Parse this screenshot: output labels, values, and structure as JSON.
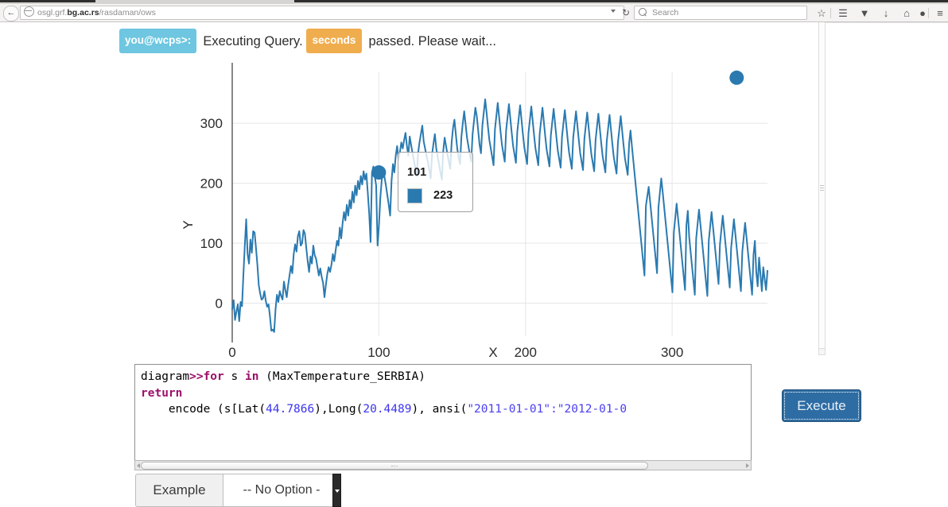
{
  "browser": {
    "back_icon": "back-arrow-icon",
    "url_prefix": "osgl.grf.",
    "url_domain": "bg.ac.rs",
    "url_suffix": "/rasdaman/ows",
    "reload_glyph": "↻",
    "search_placeholder": "Search",
    "icons": {
      "star": "☆",
      "reader": "☰",
      "pocket": "▼",
      "download": "↓",
      "home": "⌂",
      "sync": "●",
      "menu": "≡"
    }
  },
  "status": {
    "prompt": "you@wcps>:",
    "text_before": "Executing Query.",
    "seconds_badge": "seconds",
    "text_after": "passed. Please wait..."
  },
  "chart_data": {
    "type": "line",
    "title": "",
    "xlabel": "X",
    "ylabel": "Y",
    "xlim": [
      0,
      365
    ],
    "ylim": [
      -55,
      385
    ],
    "xticks": [
      0,
      100,
      200,
      300
    ],
    "yticks": [
      0,
      100,
      200,
      300
    ],
    "grid": true,
    "legend": "none",
    "line_color": "#2a7ab0",
    "marker_color": "#2a7ab0",
    "markers": [
      {
        "x": 100,
        "y": 218
      },
      {
        "x": 344,
        "y": 376
      }
    ],
    "series": [
      {
        "name": "MaxTemperature_SERBIA",
        "values": [
          -10,
          5,
          -28,
          -14,
          -2,
          -30,
          2,
          -5,
          48,
          96,
          140,
          82,
          66,
          106,
          84,
          120,
          118,
          92,
          64,
          30,
          16,
          6,
          8,
          20,
          4,
          -6,
          -2,
          -22,
          -46,
          -44,
          -48,
          -10,
          14,
          2,
          20,
          12,
          6,
          36,
          22,
          10,
          30,
          46,
          62,
          50,
          82,
          98,
          86,
          112,
          120,
          96,
          100,
          122,
          116,
          92,
          70,
          52,
          78,
          66,
          96,
          80,
          74,
          60,
          46,
          58,
          44,
          34,
          10,
          30,
          48,
          60,
          52,
          64,
          82,
          70,
          88,
          104,
          96,
          126,
          108,
          134,
          152,
          138,
          164,
          146,
          172,
          158,
          186,
          168,
          196,
          180,
          204,
          190,
          212,
          198,
          220,
          206,
          216,
          184,
          150,
          102,
          218,
          228,
          212,
          196,
          96,
          130,
          176,
          206,
          224,
          210,
          196,
          180,
          164,
          146,
          204,
          232,
          218,
          246,
          262,
          240,
          252,
          268,
          258,
          272,
          284,
          262,
          246,
          278,
          264,
          250,
          238,
          226,
          212,
          250,
          268,
          282,
          296,
          270,
          258,
          246,
          236,
          222,
          208,
          248,
          266,
          282,
          258,
          244,
          232,
          218,
          206,
          254,
          276,
          262,
          248,
          236,
          224,
          268,
          292,
          306,
          282,
          258,
          244,
          232,
          278,
          300,
          320,
          298,
          276,
          262,
          248,
          236,
          282,
          304,
          326,
          312,
          288,
          264,
          250,
          296,
          318,
          340,
          318,
          294,
          272,
          258,
          244,
          230,
          290,
          312,
          334,
          310,
          286,
          264,
          250,
          236,
          288,
          310,
          332,
          308,
          284,
          262,
          248,
          234,
          286,
          308,
          330,
          306,
          282,
          260,
          246,
          232,
          284,
          306,
          328,
          304,
          280,
          258,
          244,
          230,
          282,
          304,
          326,
          302,
          278,
          256,
          242,
          228,
          280,
          302,
          324,
          300,
          276,
          254,
          240,
          226,
          278,
          300,
          322,
          298,
          274,
          252,
          238,
          224,
          276,
          298,
          320,
          296,
          272,
          250,
          236,
          222,
          274,
          296,
          318,
          294,
          270,
          248,
          234,
          220,
          272,
          294,
          316,
          292,
          268,
          246,
          232,
          218,
          270,
          292,
          314,
          290,
          266,
          244,
          230,
          216,
          268,
          290,
          312,
          288,
          264,
          242,
          228,
          214,
          266,
          288,
          262,
          238,
          214,
          190,
          166,
          142,
          118,
          94,
          70,
          46,
          162,
          178,
          194,
          170,
          146,
          122,
          98,
          74,
          50,
          160,
          184,
          208,
          186,
          162,
          138,
          114,
          90,
          66,
          42,
          18,
          118,
          142,
          166,
          142,
          118,
          94,
          70,
          46,
          22,
          130,
          154,
          110,
          86,
          62,
          38,
          14,
          108,
          132,
          156,
          132,
          108,
          84,
          60,
          36,
          12,
          104,
          128,
          152,
          128,
          104,
          80,
          56,
          32,
          98,
          122,
          146,
          122,
          98,
          74,
          50,
          26,
          92,
          116,
          140,
          116,
          92,
          68,
          44,
          20,
          86,
          110,
          134,
          110,
          86,
          62,
          38,
          14,
          80,
          104,
          52,
          28,
          76,
          48,
          20,
          60,
          40,
          22,
          54
        ]
      }
    ]
  },
  "tooltip": {
    "x_value": "101",
    "y_value": "223"
  },
  "query": {
    "line1_a": "diagram",
    "line1_b": ">>for",
    "line1_c": " s ",
    "line1_d": "in",
    "line1_e": " (MaxTemperature_SERBIA)",
    "line2": "return",
    "line3_a": "    encode (s[Lat(",
    "line3_num1": "44.7866",
    "line3_b": "),Long(",
    "line3_num2": "20.4489",
    "line3_c": "), ansi(",
    "line3_str": "\"2011-01-01\":\"2012-01-0"
  },
  "buttons": {
    "execute": "Execute"
  },
  "example": {
    "label": "Example",
    "selected_option": "-- No Option -"
  }
}
